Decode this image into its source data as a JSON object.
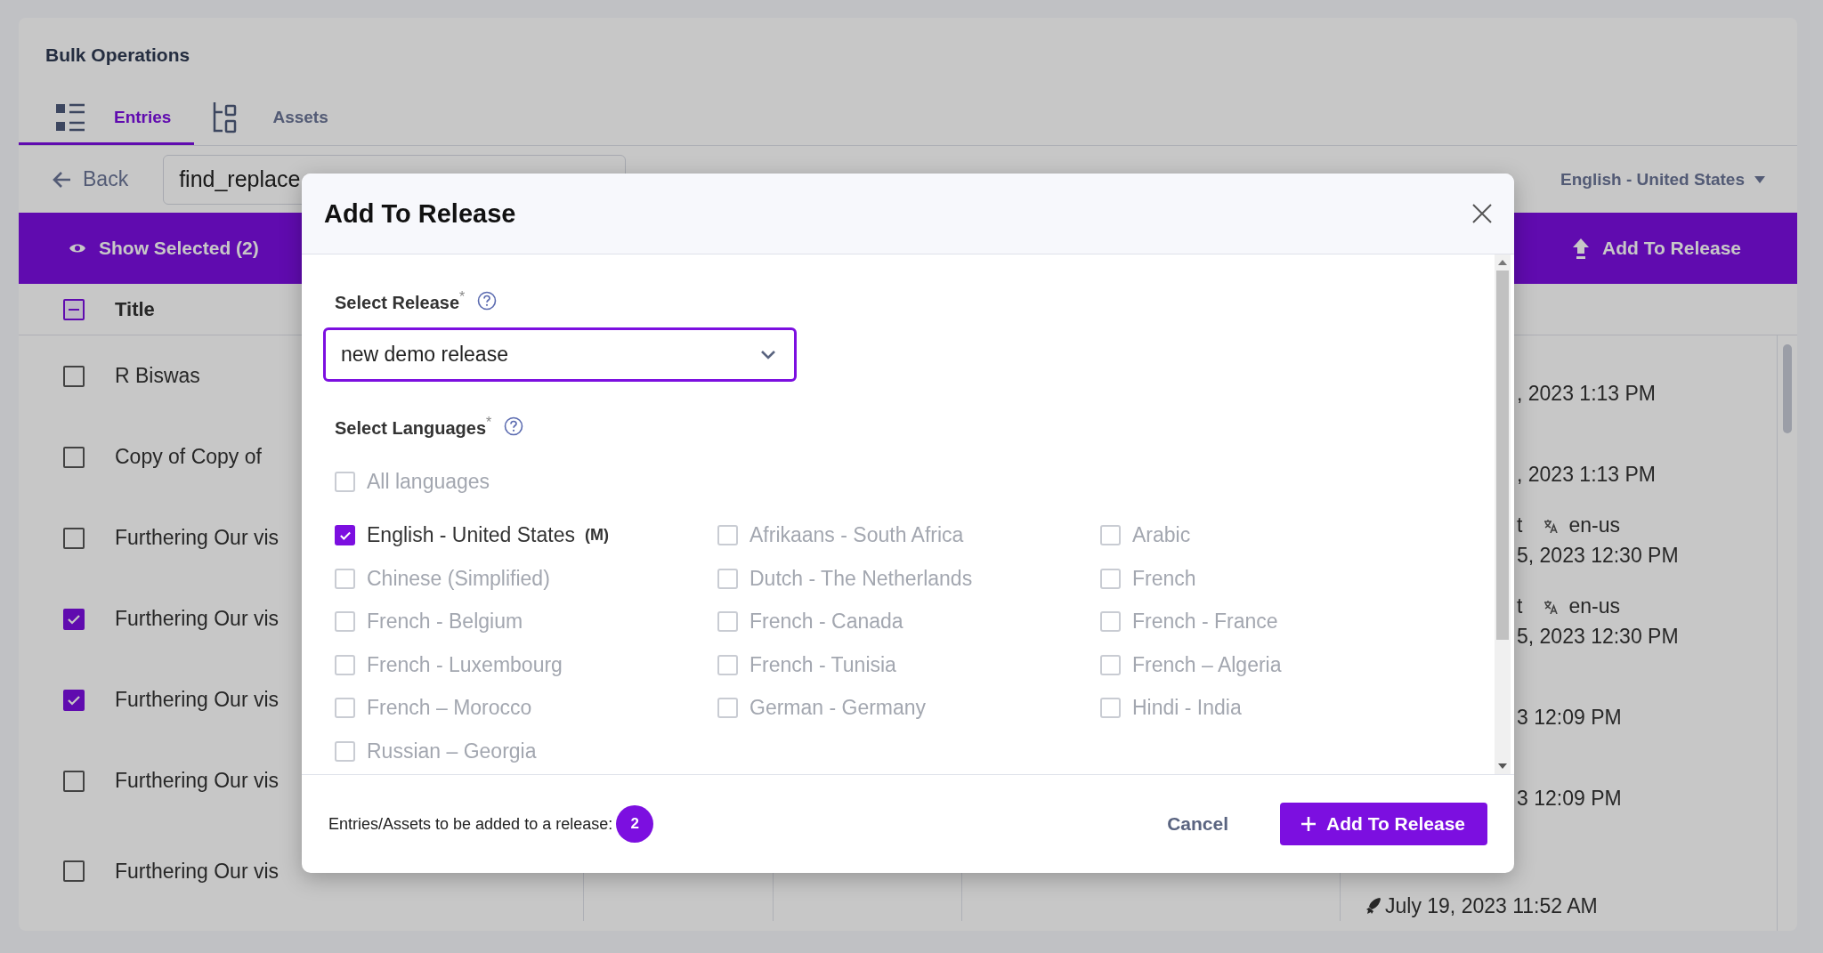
{
  "app_title": "Bulk Operations",
  "tabs": [
    {
      "label": "Entries",
      "selected": true,
      "kind": "entries"
    },
    {
      "label": "Assets",
      "selected": false,
      "kind": "assets"
    }
  ],
  "toolbar": {
    "back": "Back",
    "search_value": "find_replace",
    "locale": "English - United States"
  },
  "action_bar": {
    "show_selected": "Show Selected (2)",
    "add_to_release": "Add To Release"
  },
  "table": {
    "select_all_partial": true,
    "title_column": "Title",
    "rows": [
      {
        "title": "R Biswas",
        "checked": false,
        "date": ", 2023 1:13 PM"
      },
      {
        "title": "Copy of Copy of",
        "checked": false,
        "date": ", 2023 1:13 PM"
      },
      {
        "title": "Furthering Our vis",
        "checked": false,
        "line_1": "t",
        "locale": "en-us",
        "date": "5, 2023 12:30 PM"
      },
      {
        "title": "Furthering Our vis",
        "checked": true,
        "line_1": "t",
        "locale": "en-us",
        "date": "5, 2023 12:30 PM"
      },
      {
        "title": "Furthering Our vis",
        "checked": true,
        "date": "3 12:09 PM"
      },
      {
        "title": "Furthering Our vis",
        "checked": false,
        "date": "3 12:09 PM"
      },
      {
        "title": "Furthering Our vis",
        "checked": false,
        "date": "July 19, 2023 11:52 AM",
        "status_icon": true
      }
    ]
  },
  "modal": {
    "title": "Add To Release",
    "release_label": "Select Release$^{*}$",
    "release_value": "new demo release",
    "languages_label": "Select Languages$^{*}$",
    "all_languages": {
      "label": "All languages",
      "checked": false
    },
    "languages": [
      {
        "label": "English - United States",
        "tag": "(M)",
        "checked": true
      },
      {
        "label": "Afrikaans - South Africa",
        "checked": false
      },
      {
        "label": "Arabic",
        "checked": false
      },
      {
        "label": "Chinese (Simplified)",
        "checked": false
      },
      {
        "label": "Dutch - The Netherlands",
        "checked": false
      },
      {
        "label": "French",
        "checked": false
      },
      {
        "label": "French - Belgium",
        "checked": false
      },
      {
        "label": "French - Canada",
        "checked": false
      },
      {
        "label": "French - France",
        "checked": false
      },
      {
        "label": "French - Luxembourg",
        "checked": false
      },
      {
        "label": "French - Tunisia",
        "checked": false
      },
      {
        "label": "French – Algeria",
        "checked": false
      },
      {
        "label": "French – Morocco",
        "checked": false
      },
      {
        "label": "German - Germany",
        "checked": false
      },
      {
        "label": "Hindi - India",
        "checked": false
      },
      {
        "label": "Russian – Georgia",
        "checked": false
      }
    ],
    "footer_text": "Entries/Assets to be added to a release:",
    "count": "2",
    "cancel": "Cancel",
    "submit": "Add To Release"
  }
}
